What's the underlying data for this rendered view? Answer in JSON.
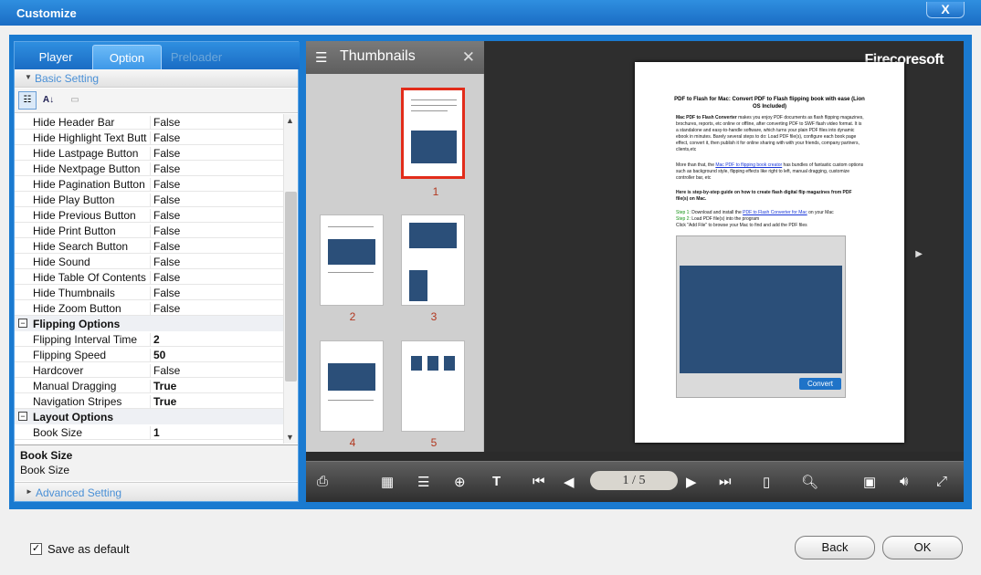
{
  "window": {
    "title": "Customize",
    "close_label": "X"
  },
  "tabs": [
    {
      "label": "Player"
    },
    {
      "label": "Option"
    },
    {
      "label": "Preloader"
    }
  ],
  "basic_setting_label": "Basic Setting",
  "advanced_setting_label": "Advanced Setting",
  "properties": {
    "hide_rows": [
      {
        "name": "Hide Header Bar",
        "value": "False"
      },
      {
        "name": "Hide Highlight Text Butt",
        "value": "False"
      },
      {
        "name": "Hide Lastpage Button",
        "value": "False"
      },
      {
        "name": "Hide Nextpage Button",
        "value": "False"
      },
      {
        "name": "Hide Pagination Button",
        "value": "False"
      },
      {
        "name": "Hide Play Button",
        "value": "False"
      },
      {
        "name": "Hide Previous Button",
        "value": "False"
      },
      {
        "name": "Hide Print Button",
        "value": "False"
      },
      {
        "name": "Hide Search Button",
        "value": "False"
      },
      {
        "name": "Hide Sound",
        "value": "False"
      },
      {
        "name": "Hide Table Of Contents",
        "value": "False"
      },
      {
        "name": "Hide Thumbnails",
        "value": "False"
      },
      {
        "name": "Hide Zoom Button",
        "value": "False"
      }
    ],
    "flipping_category": "Flipping Options",
    "flipping_rows": [
      {
        "name": "Flipping Interval Time",
        "value": "2"
      },
      {
        "name": "Flipping Speed",
        "value": "50"
      },
      {
        "name": "Hardcover",
        "value": "False"
      },
      {
        "name": "Manual Dragging",
        "value": "True"
      },
      {
        "name": "Navigation Stripes",
        "value": "True"
      }
    ],
    "layout_category": "Layout Options",
    "layout_rows": [
      {
        "name": "Book Size",
        "value": "1"
      }
    ]
  },
  "help": {
    "title": "Book Size",
    "description": "Book Size"
  },
  "thumbnails": {
    "title": "Thumbnails",
    "pages": [
      "1",
      "2",
      "3",
      "4",
      "5"
    ]
  },
  "brand": "Firecoresoft",
  "document": {
    "title": "PDF to Flash for Mac: Convert PDF to Flash flipping book with ease (Lion OS Included)",
    "para1_a": "Mac PDF to Flash Converter",
    "para1_b": " makes you enjoy PDF documents as flash flipping magazines, brochures, reports, etc online or offline, after converting PDF to SWF flash video format. It is a standalone and easy-to-handle software, which turns your plain PDF files into dynamic ebook in minutes. Barely several steps to do: Load PDF file(s), configure each book page effect, convert it, then publish it for online sharing with with your friends, company partners, clients,etc",
    "para2_a": "More than that, the ",
    "para2_link": "Mac PDF to flipping book creator",
    "para2_b": " has bundles of fantastic custom options such as background style, flipping effects like right to left, manual dragging, customize controller bar, etc",
    "para3": "Here is step-by-step guide on how to create flash digital flip magazines from PDF file(s) on Mac.",
    "step1_label": "Step 1:",
    "step1_text": " Download and install the ",
    "step1_link": "PDF to Flash Converter for Mac",
    "step1_end": " on your Mac",
    "step2_label": "Step 2:",
    "step2_text": " Load PDF file(s) into the program",
    "step3": "Click \"Add File\" to browse your Mac to find and add the PDF files",
    "shot_convert": "Convert"
  },
  "controls": {
    "current_page": "1",
    "separator": "/",
    "total_pages": "5"
  },
  "footer": {
    "save_default_label": "Save as default",
    "save_default_checked": true,
    "back_label": "Back",
    "ok_label": "OK"
  },
  "colors": {
    "accent": "#1a7ad0",
    "selected_thumb_border": "#e22c1a",
    "link": "#1836d8"
  }
}
